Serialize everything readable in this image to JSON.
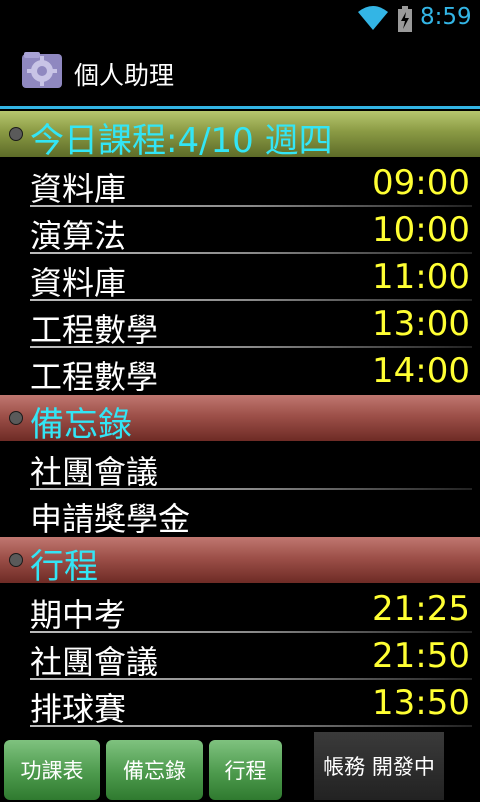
{
  "status_bar": {
    "time": "8:59",
    "icons": [
      "wifi-icon",
      "battery-charging-icon"
    ],
    "time_color": "#33b5e5"
  },
  "action_bar": {
    "title": "個人助理",
    "icon": "app-gear-icon",
    "underline_color": "#33b5e5"
  },
  "sections": {
    "courses": {
      "header": "今日課程:4/10 週四",
      "color": "#8a9a44",
      "items": [
        {
          "name": "資料庫",
          "time": "09:00"
        },
        {
          "name": "演算法",
          "time": "10:00"
        },
        {
          "name": "資料庫",
          "time": "11:00"
        },
        {
          "name": "工程數學",
          "time": "13:00"
        },
        {
          "name": "工程數學",
          "time": "14:00"
        }
      ]
    },
    "memo": {
      "header": "備忘錄",
      "color": "#9d5049",
      "items": [
        {
          "name": "社團會議"
        },
        {
          "name": "申請獎學金"
        }
      ]
    },
    "schedule": {
      "header": "行程",
      "color": "#9d5049",
      "items": [
        {
          "name": "期中考",
          "time": "21:25"
        },
        {
          "name": "社團會議",
          "time": "21:50"
        },
        {
          "name": "排球賽",
          "time": "13:50"
        }
      ]
    }
  },
  "bottom_bar": {
    "buttons": [
      {
        "label": "功課表"
      },
      {
        "label": "備忘錄"
      },
      {
        "label": "行程"
      },
      {
        "label": "帳務  開發中"
      }
    ],
    "button_color": "#4d9a4d"
  },
  "colors": {
    "header_text": "#33e5f5",
    "time_text": "#ffff33"
  }
}
